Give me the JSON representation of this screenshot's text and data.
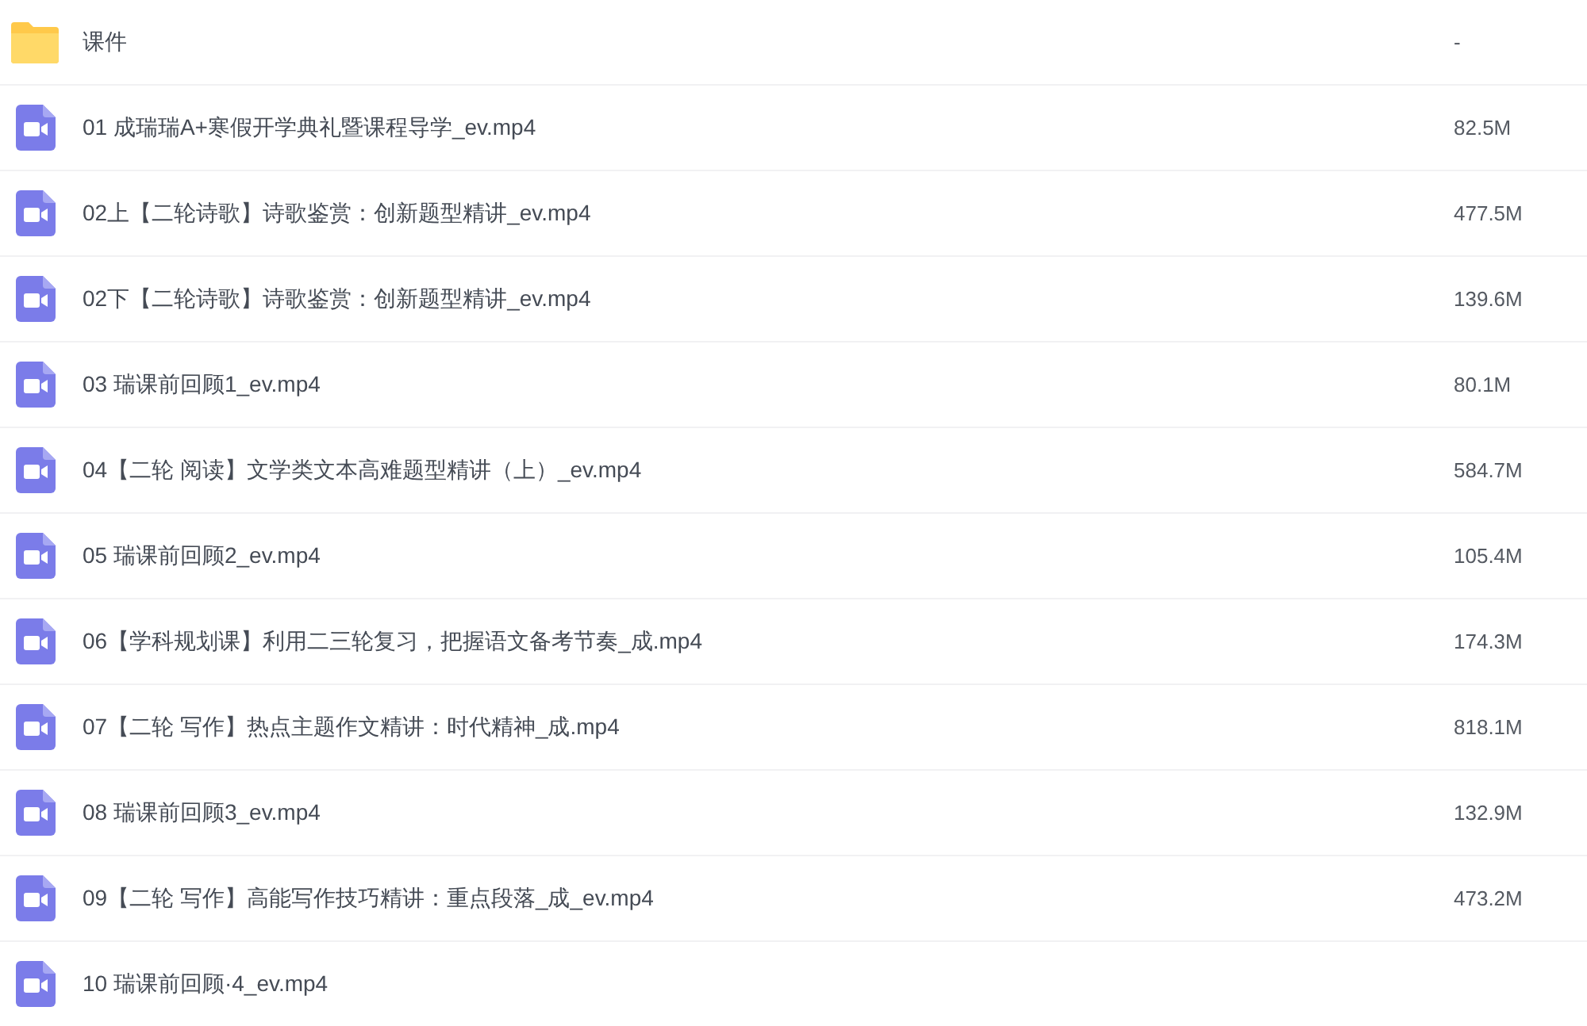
{
  "rows": [
    {
      "kind": "folder",
      "name": "课件",
      "size": "-"
    },
    {
      "kind": "video",
      "name": "01 成瑞瑞A+寒假开学典礼暨课程导学_ev.mp4",
      "size": "82.5M"
    },
    {
      "kind": "video",
      "name": "02上【二轮诗歌】诗歌鉴赏：创新题型精讲_ev.mp4",
      "size": "477.5M"
    },
    {
      "kind": "video",
      "name": "02下【二轮诗歌】诗歌鉴赏：创新题型精讲_ev.mp4",
      "size": "139.6M"
    },
    {
      "kind": "video",
      "name": "03 瑞课前回顾1_ev.mp4",
      "size": "80.1M"
    },
    {
      "kind": "video",
      "name": "04【二轮 阅读】文学类文本高难题型精讲（上）_ev.mp4",
      "size": "584.7M"
    },
    {
      "kind": "video",
      "name": "05 瑞课前回顾2_ev.mp4",
      "size": "105.4M"
    },
    {
      "kind": "video",
      "name": "06【学科规划课】利用二三轮复习，把握语文备考节奏_成.mp4",
      "size": "174.3M"
    },
    {
      "kind": "video",
      "name": "07【二轮 写作】热点主题作文精讲：时代精神_成.mp4",
      "size": "818.1M"
    },
    {
      "kind": "video",
      "name": "08 瑞课前回顾3_ev.mp4",
      "size": "132.9M"
    },
    {
      "kind": "video",
      "name": "09【二轮 写作】高能写作技巧精讲：重点段落_成_ev.mp4",
      "size": "473.2M"
    },
    {
      "kind": "video",
      "name": "10 瑞课前回顾·4_ev.mp4"
    }
  ]
}
